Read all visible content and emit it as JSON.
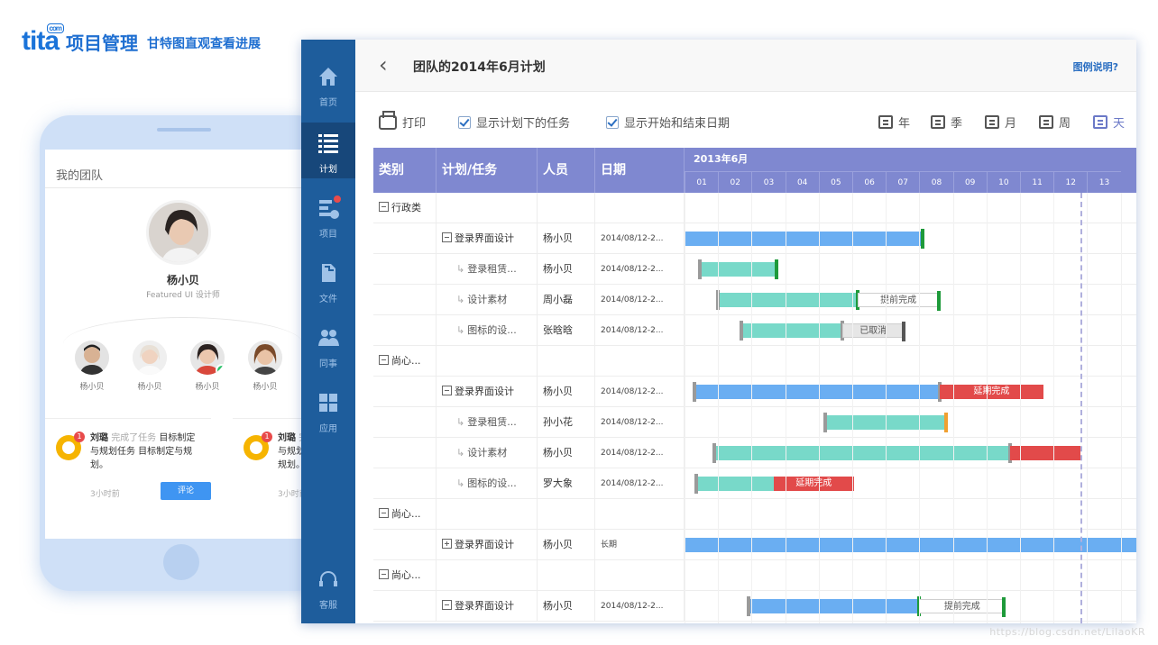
{
  "brand": {
    "logo": "tita",
    "logo_sup": "com",
    "product": "项目管理",
    "tagline": "甘特图直观查看进展"
  },
  "phone": {
    "title": "我的团队",
    "leader": {
      "name": "杨小贝",
      "role": "Featured UI 设计师"
    },
    "members": [
      {
        "name": "杨小贝"
      },
      {
        "name": "杨小贝"
      },
      {
        "name": "杨小贝"
      },
      {
        "name": "杨小贝"
      }
    ],
    "notifications": [
      {
        "badge": "1",
        "who": "刘璐",
        "action": "完成了任务",
        "content": "目标制定与规划任务 目标制定与规划。",
        "time": "3小时前",
        "button": "评论"
      },
      {
        "badge": "1",
        "who": "刘璐",
        "action": "完",
        "content": "定与规划任 规划。",
        "time": "3小时前"
      }
    ]
  },
  "sidenav": [
    {
      "label": "首页",
      "icon": "home-icon",
      "active": false
    },
    {
      "label": "计划",
      "icon": "list-icon",
      "active": true
    },
    {
      "label": "项目",
      "icon": "project-icon",
      "active": false,
      "badge": true
    },
    {
      "label": "文件",
      "icon": "file-icon",
      "active": false
    },
    {
      "label": "同事",
      "icon": "people-icon",
      "active": false
    },
    {
      "label": "应用",
      "icon": "apps-icon",
      "active": false
    },
    {
      "label": "客服",
      "icon": "headset-icon",
      "active": false
    }
  ],
  "header": {
    "back": "‹",
    "title": "团队的2014年6月计划",
    "help": "图例说明?"
  },
  "toolbar": {
    "print": "打印",
    "show_tasks": "显示计划下的任务",
    "show_dates": "显示开始和结束日期",
    "views": [
      "年",
      "季",
      "月",
      "周",
      "天"
    ],
    "active_view": "天"
  },
  "gantt": {
    "columns": [
      "类别",
      "计划/任务",
      "人员",
      "日期"
    ],
    "month": "2013年6月",
    "days": [
      "01",
      "02",
      "03",
      "04",
      "05",
      "06",
      "07",
      "08",
      "09",
      "10",
      "11",
      "12",
      "13"
    ],
    "colors": {
      "plan": "#6aaef2",
      "task": "#78d9c9",
      "late": "#e24a4a",
      "done": "#1e9a3a",
      "muted": "#9a9a9a",
      "orange": "#f0a030"
    },
    "rows": [
      {
        "kind": "category",
        "category": "行政类"
      },
      {
        "kind": "plan",
        "task": "登录界面设计",
        "person": "杨小贝",
        "date": "2014/08/12-2...",
        "bars": [
          {
            "from": 0.0,
            "to": 7.1,
            "color": "plan",
            "end": "done"
          }
        ]
      },
      {
        "kind": "task",
        "task": "登录租赁...",
        "person": "杨小贝",
        "date": "2014/08/12-2...",
        "bars": [
          {
            "from": 0.45,
            "to": 2.75,
            "color": "task",
            "start": "muted",
            "end": "done"
          }
        ]
      },
      {
        "kind": "task",
        "task": "设计素材",
        "person": "周小磊",
        "date": "2014/08/12-2...",
        "bars": [
          {
            "from": 1.0,
            "to": 5.15,
            "color": "task",
            "start": "muted",
            "end": "done"
          },
          {
            "from": 5.15,
            "to": 7.6,
            "color": "outline",
            "end": "done",
            "label": "提前完成"
          }
        ]
      },
      {
        "kind": "task",
        "task": "图标的设...",
        "person": "张晗晗",
        "date": "2014/08/12-2...",
        "bars": [
          {
            "from": 1.7,
            "to": 4.7,
            "color": "task",
            "start": "muted",
            "end": "muted"
          },
          {
            "from": 4.7,
            "to": 6.55,
            "color": "grey",
            "end": "dark",
            "label": "已取消"
          }
        ]
      },
      {
        "kind": "category",
        "category": "尚心..."
      },
      {
        "kind": "plan",
        "task": "登录界面设计",
        "person": "杨小贝",
        "date": "2014/08/12-2...",
        "bars": [
          {
            "from": 0.3,
            "to": 7.6,
            "color": "plan",
            "start": "muted",
            "end": "muted"
          },
          {
            "from": 7.6,
            "to": 10.7,
            "color": "late",
            "label": "延期完成"
          }
        ]
      },
      {
        "kind": "task",
        "task": "登录租赁...",
        "person": "孙小花",
        "date": "2014/08/12-2...",
        "bars": [
          {
            "from": 4.2,
            "to": 7.8,
            "color": "task",
            "start": "muted",
            "end": "orange"
          }
        ]
      },
      {
        "kind": "task",
        "task": "设计素材",
        "person": "杨小贝",
        "date": "2014/08/12-2...",
        "bars": [
          {
            "from": 0.9,
            "to": 9.7,
            "color": "task",
            "start": "muted",
            "end": "muted"
          },
          {
            "from": 9.7,
            "to": 11.8,
            "color": "late"
          }
        ]
      },
      {
        "kind": "task",
        "task": "图标的设...",
        "person": "罗大象",
        "date": "2014/08/12-2...",
        "bars": [
          {
            "from": 0.35,
            "to": 2.65,
            "color": "task",
            "start": "muted"
          },
          {
            "from": 2.65,
            "to": 5.05,
            "color": "late",
            "label": "延期完成"
          }
        ]
      },
      {
        "kind": "category",
        "category": "尚心..."
      },
      {
        "kind": "plan-collapsed",
        "task": "登录界面设计",
        "person": "杨小贝",
        "date": "长期",
        "bars": [
          {
            "from": 0.0,
            "to": 13.5,
            "color": "plan"
          }
        ]
      },
      {
        "kind": "category",
        "category": "尚心..."
      },
      {
        "kind": "plan",
        "task": "登录界面设计",
        "person": "杨小贝",
        "date": "2014/08/12-2...",
        "bars": [
          {
            "from": 1.9,
            "to": 7.0,
            "color": "plan",
            "start": "muted",
            "end": "done"
          },
          {
            "from": 7.0,
            "to": 9.55,
            "color": "outline",
            "end": "done",
            "label": "提前完成"
          }
        ]
      }
    ],
    "today_index": 11.8
  },
  "watermark": "https://blog.csdn.net/LilaoKR"
}
